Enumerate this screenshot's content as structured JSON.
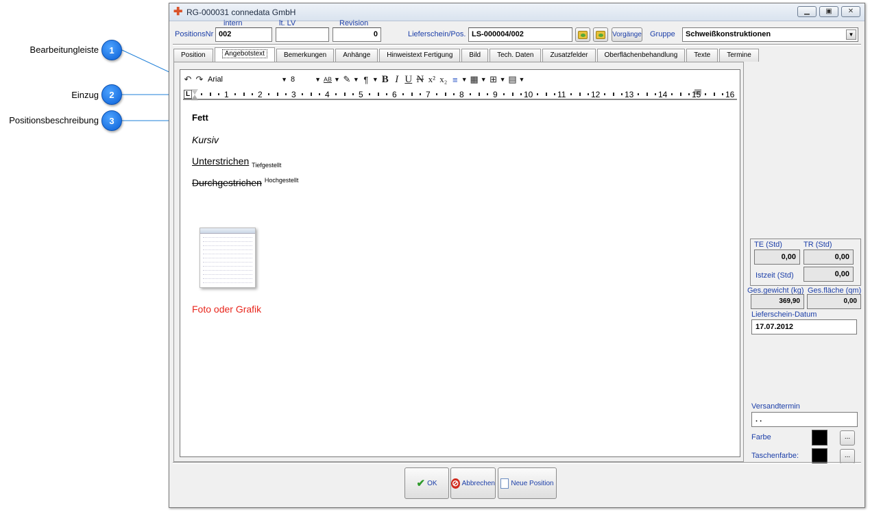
{
  "callouts": [
    {
      "label": "Bearbeitungleiste",
      "number": "1"
    },
    {
      "label": "Einzug",
      "number": "2"
    },
    {
      "label": "Positionsbeschreibung",
      "number": "3"
    }
  ],
  "window": {
    "title": "RG-000031 connedata GmbH",
    "controls": [
      "minimize",
      "maximize",
      "close"
    ]
  },
  "header": {
    "positionsnr_label": "PositionsNr",
    "positionsnr_value": "002",
    "intern_label": "intern",
    "lt_lv_label": "lt. LV",
    "lt_lv_value": "",
    "revision_label": "Revision",
    "revision_value": "0",
    "lieferschein_label": "Lieferschein/Pos.",
    "lieferschein_value": "LS-000004/002",
    "vorgaenge_label": "Vorgänge",
    "gruppe_label": "Gruppe",
    "gruppe_value": "Schweißkonstruktionen"
  },
  "tabs": [
    {
      "label": "Position",
      "active": false
    },
    {
      "label": "Angebotstext",
      "active": true
    },
    {
      "label": "Bemerkungen",
      "active": false
    },
    {
      "label": "Anhänge",
      "active": false
    },
    {
      "label": "Hinweistext Fertigung",
      "active": false
    },
    {
      "label": "Bild",
      "active": false
    },
    {
      "label": "Tech. Daten",
      "active": false
    },
    {
      "label": "Zusatzfelder",
      "active": false
    },
    {
      "label": "Oberflächenbehandlung",
      "active": false
    },
    {
      "label": "Texte",
      "active": false
    },
    {
      "label": "Termine",
      "active": false
    }
  ],
  "toolbar": {
    "font": "Arial",
    "size": "8",
    "bold": "B",
    "italic": "I",
    "underline": "U",
    "strike": "N",
    "superscript": "x²",
    "subscript": "x₂"
  },
  "ruler": {
    "start_marker": "L",
    "numbers": [
      "1",
      "2",
      "3",
      "4",
      "5",
      "6",
      "7",
      "8",
      "9",
      "10",
      "11",
      "12",
      "13",
      "14",
      "15",
      "16"
    ]
  },
  "content": {
    "bold": "Fett",
    "italic": "Kursiv",
    "underline": "Unterstrichen",
    "subscript": "Tiefgestellt",
    "strike": "Durchgestrichen",
    "superscript": "Hochgestellt",
    "image_caption": "Foto oder Grafik",
    "caption_color": "#e8261c"
  },
  "right_panel": {
    "te_label": "TE (Std)",
    "te_value": "0,00",
    "tr_label": "TR (Std)",
    "tr_value": "0,00",
    "istzeit_label": "Istzeit (Std)",
    "istzeit_value": "0,00",
    "gewicht_label": "Ges.gewicht (kg)",
    "gewicht_value": "369,90",
    "flaeche_label": "Ges.fläche (qm)",
    "flaeche_value": "0,00",
    "lieferschein_datum_label": "Lieferschein-Datum",
    "lieferschein_datum_value": "17.07.2012",
    "versandtermin_label": "Versandtermin",
    "versandtermin_value": " .  . ",
    "farbe_label": "Farbe",
    "taschenfarbe_label": "Taschenfarbe:",
    "dots": "..."
  },
  "buttons": {
    "ok": "OK",
    "abbrechen": "Abbrechen",
    "neue_position": "Neue Position"
  }
}
